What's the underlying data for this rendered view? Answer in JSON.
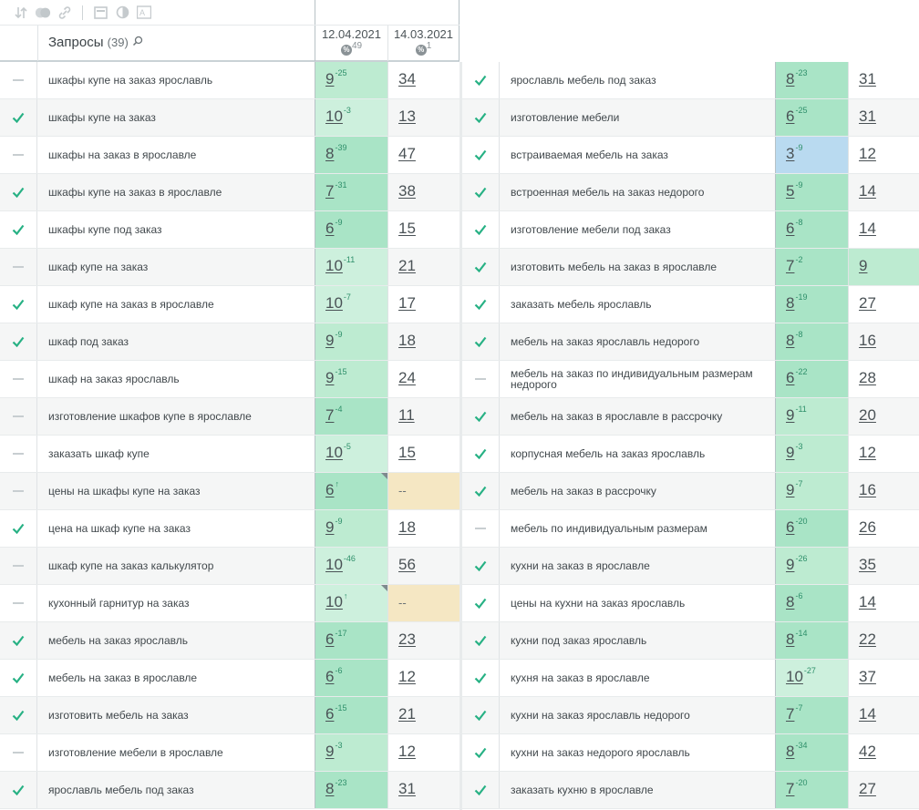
{
  "toolbar": {
    "icons": [
      "sort-icon",
      "toggle-icon",
      "link-icon",
      "calendar-icon",
      "contrast-icon",
      "text-size-icon"
    ]
  },
  "header": {
    "title": "Запросы",
    "count": "(39)",
    "date1": "12.04.2021",
    "date1_pct": "%",
    "date1_sup": "49",
    "date2": "14.03.2021",
    "date2_pct": "%",
    "date2_sup": "1"
  },
  "colors": {
    "green_strong": "#a9e4c6",
    "green_light": "#cdf0dd",
    "green_mid": "#bdebd1",
    "blue": "#b9daf0",
    "yellow": "#f5e7c3",
    "check": "#27b184"
  },
  "left_rows": [
    {
      "check": false,
      "query": "шкафы купе на заказ ярославль",
      "pos1": "9",
      "d1": "-25",
      "pos2": "34",
      "bg": "green_mid"
    },
    {
      "check": true,
      "query": "шкафы купе на заказ",
      "pos1": "10",
      "d1": "-3",
      "pos2": "13",
      "bg": "green_light"
    },
    {
      "check": false,
      "query": "шкафы на заказ в ярославле",
      "pos1": "8",
      "d1": "-39",
      "pos2": "47",
      "bg": "green_strong"
    },
    {
      "check": true,
      "query": "шкафы купе на заказ в ярославле",
      "pos1": "7",
      "d1": "-31",
      "pos2": "38",
      "bg": "green_strong"
    },
    {
      "check": true,
      "query": "шкафы купе под заказ",
      "pos1": "6",
      "d1": "-9",
      "pos2": "15",
      "bg": "green_strong"
    },
    {
      "check": false,
      "query": "шкаф купе на заказ",
      "pos1": "10",
      "d1": "-11",
      "pos2": "21",
      "bg": "green_light"
    },
    {
      "check": true,
      "query": "шкаф купе на заказ в ярославле",
      "pos1": "10",
      "d1": "-7",
      "pos2": "17",
      "bg": "green_light"
    },
    {
      "check": true,
      "query": "шкаф под заказ",
      "pos1": "9",
      "d1": "-9",
      "pos2": "18",
      "bg": "green_mid"
    },
    {
      "check": false,
      "query": "шкаф на заказ ярославль",
      "pos1": "9",
      "d1": "-15",
      "pos2": "24",
      "bg": "green_mid"
    },
    {
      "check": false,
      "query": "изготовление шкафов купе в ярославле",
      "pos1": "7",
      "d1": "-4",
      "pos2": "11",
      "bg": "green_strong"
    },
    {
      "check": false,
      "query": "заказать шкаф купе",
      "pos1": "10",
      "d1": "-5",
      "pos2": "15",
      "bg": "green_light"
    },
    {
      "check": false,
      "query": "цены на шкафы купе на заказ",
      "pos1": "6",
      "d1": "↑",
      "pos2": "--",
      "bg": "green_strong",
      "bg2": "yellow",
      "tri": true
    },
    {
      "check": true,
      "query": "цена на шкаф купе на заказ",
      "pos1": "9",
      "d1": "-9",
      "pos2": "18",
      "bg": "green_mid"
    },
    {
      "check": false,
      "query": "шкаф купе на заказ калькулятор",
      "pos1": "10",
      "d1": "-46",
      "pos2": "56",
      "bg": "green_light"
    },
    {
      "check": false,
      "query": "кухонный гарнитур на заказ",
      "pos1": "10",
      "d1": "↑",
      "pos2": "--",
      "bg": "green_light",
      "bg2": "yellow",
      "tri": true
    },
    {
      "check": true,
      "query": "мебель на заказ ярославль",
      "pos1": "6",
      "d1": "-17",
      "pos2": "23",
      "bg": "green_strong"
    },
    {
      "check": true,
      "query": "мебель на заказ в ярославле",
      "pos1": "6",
      "d1": "-6",
      "pos2": "12",
      "bg": "green_strong"
    },
    {
      "check": true,
      "query": "изготовить мебель на заказ",
      "pos1": "6",
      "d1": "-15",
      "pos2": "21",
      "bg": "green_strong"
    },
    {
      "check": false,
      "query": "изготовление мебели в ярославле",
      "pos1": "9",
      "d1": "-3",
      "pos2": "12",
      "bg": "green_mid"
    },
    {
      "check": true,
      "query": "ярославль мебель под заказ",
      "pos1": "8",
      "d1": "-23",
      "pos2": "31",
      "bg": "green_strong"
    }
  ],
  "right_rows": [
    {
      "check": true,
      "query": "ярославль мебель под заказ",
      "pos1": "8",
      "d1": "-23",
      "pos2": "31",
      "bg": "green_strong"
    },
    {
      "check": true,
      "query": "изготовление мебели",
      "pos1": "6",
      "d1": "-25",
      "pos2": "31",
      "bg": "green_strong"
    },
    {
      "check": true,
      "query": "встраиваемая мебель на заказ",
      "pos1": "3",
      "d1": "-9",
      "pos2": "12",
      "bg": "blue"
    },
    {
      "check": true,
      "query": "встроенная мебель на заказ недорого",
      "pos1": "5",
      "d1": "-9",
      "pos2": "14",
      "bg": "green_strong"
    },
    {
      "check": true,
      "query": "изготовление мебели под заказ",
      "pos1": "6",
      "d1": "-8",
      "pos2": "14",
      "bg": "green_strong"
    },
    {
      "check": true,
      "query": "изготовить мебель на заказ в ярославле",
      "pos1": "7",
      "d1": "-2",
      "pos2": "9",
      "bg": "green_strong",
      "bg2": "green_mid"
    },
    {
      "check": true,
      "query": "заказать мебель ярославль",
      "pos1": "8",
      "d1": "-19",
      "pos2": "27",
      "bg": "green_strong"
    },
    {
      "check": true,
      "query": "мебель на заказ ярославль недорого",
      "pos1": "8",
      "d1": "-8",
      "pos2": "16",
      "bg": "green_strong"
    },
    {
      "check": false,
      "query": "мебель на заказ по индивидуальным размерам недорого",
      "pos1": "6",
      "d1": "-22",
      "pos2": "28",
      "bg": "green_strong"
    },
    {
      "check": true,
      "query": "мебель на заказ в ярославле в рассрочку",
      "pos1": "9",
      "d1": "-11",
      "pos2": "20",
      "bg": "green_mid"
    },
    {
      "check": true,
      "query": "корпусная мебель на заказ ярославль",
      "pos1": "9",
      "d1": "-3",
      "pos2": "12",
      "bg": "green_mid"
    },
    {
      "check": true,
      "query": "мебель на заказ в рассрочку",
      "pos1": "9",
      "d1": "-7",
      "pos2": "16",
      "bg": "green_mid"
    },
    {
      "check": false,
      "query": "мебель по индивидуальным размерам",
      "pos1": "6",
      "d1": "-20",
      "pos2": "26",
      "bg": "green_strong"
    },
    {
      "check": true,
      "query": "кухни на заказ в ярославле",
      "pos1": "9",
      "d1": "-26",
      "pos2": "35",
      "bg": "green_mid"
    },
    {
      "check": true,
      "query": "цены на кухни на заказ ярославль",
      "pos1": "8",
      "d1": "-6",
      "pos2": "14",
      "bg": "green_strong"
    },
    {
      "check": true,
      "query": "кухни под заказ ярославль",
      "pos1": "8",
      "d1": "-14",
      "pos2": "22",
      "bg": "green_strong"
    },
    {
      "check": true,
      "query": "кухня на заказ в ярославле",
      "pos1": "10",
      "d1": "-27",
      "pos2": "37",
      "bg": "green_light"
    },
    {
      "check": true,
      "query": "кухни на заказ ярославль недорого",
      "pos1": "7",
      "d1": "-7",
      "pos2": "14",
      "bg": "green_strong"
    },
    {
      "check": true,
      "query": "кухни на заказ недорого ярославль",
      "pos1": "8",
      "d1": "-34",
      "pos2": "42",
      "bg": "green_strong"
    },
    {
      "check": true,
      "query": "заказать кухню в ярославле",
      "pos1": "7",
      "d1": "-20",
      "pos2": "27",
      "bg": "green_strong"
    }
  ]
}
